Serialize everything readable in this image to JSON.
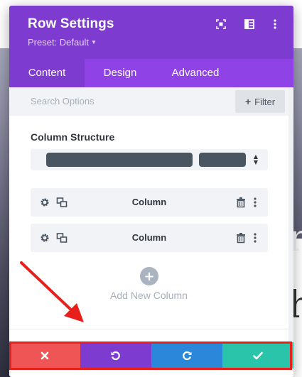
{
  "modal": {
    "title": "Row Settings",
    "preset_label": "Preset: Default",
    "header_icons": [
      "expand-icon",
      "sidebar-layout-icon",
      "more-vertical-icon"
    ],
    "colors": {
      "header": "#7d3bcf",
      "tabs": "#8f42e5",
      "accent_highlight": "#e8201c"
    }
  },
  "tabs": [
    {
      "label": "Content",
      "active": true
    },
    {
      "label": "Design",
      "active": false
    },
    {
      "label": "Advanced",
      "active": false
    }
  ],
  "search": {
    "placeholder": "Search Options",
    "filter_label": "Filter"
  },
  "column_structure": {
    "label": "Column Structure"
  },
  "columns": [
    {
      "label": "Column"
    },
    {
      "label": "Column"
    }
  ],
  "add_column": {
    "label": "Add New Column"
  },
  "footer": {
    "buttons": [
      {
        "name": "cancel",
        "icon": "close-icon",
        "color": "#ef5555"
      },
      {
        "name": "undo",
        "icon": "undo-icon",
        "color": "#7e3bd0"
      },
      {
        "name": "redo",
        "icon": "redo-icon",
        "color": "#2b87da"
      },
      {
        "name": "save",
        "icon": "check-icon",
        "color": "#29c4a9"
      }
    ]
  }
}
